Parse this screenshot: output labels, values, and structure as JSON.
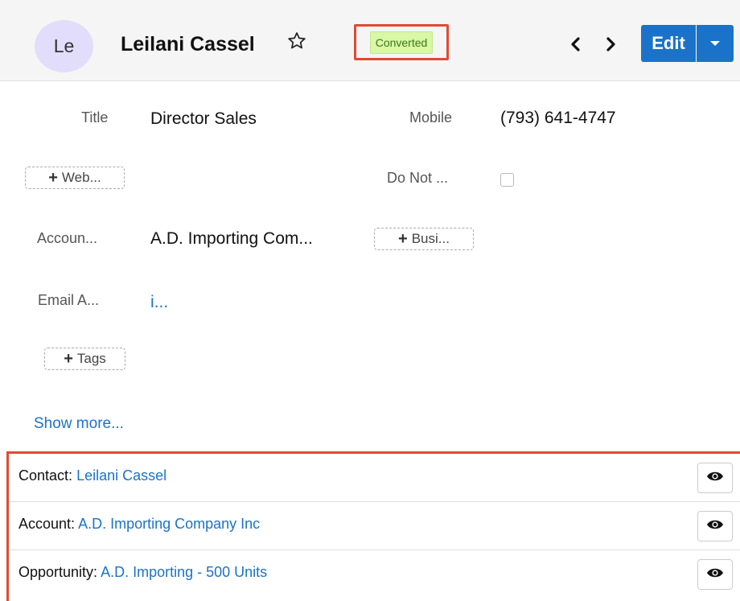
{
  "header": {
    "avatar_initials": "Le",
    "record_name": "Leilani Cassel",
    "status_badge": "Converted",
    "edit_label": "Edit",
    "icons": [
      "star-icon",
      "chevron-left-icon",
      "chevron-right-icon",
      "caret-down-icon"
    ],
    "colors": {
      "badge_bg": "#d8f7a7",
      "badge_text": "#3d7a0e",
      "primary": "#1a73c8",
      "highlight": "#e24a33"
    }
  },
  "fields": {
    "title_label": "Title",
    "title_value": "Director Sales",
    "mobile_label": "Mobile",
    "mobile_value": "(793) 641-4747",
    "website_add": "Web...",
    "do_not_label": "Do Not ...",
    "do_not_checked": false,
    "account_label": "Accoun...",
    "account_value": "A.D. Importing Com...",
    "business_add": "Busi...",
    "email_label": "Email A...",
    "email_value": "i...",
    "tags_add": "Tags",
    "show_more": "Show more..."
  },
  "related": [
    {
      "label": "Contact:",
      "link": "Leilani Cassel"
    },
    {
      "label": "Account:",
      "link": "A.D. Importing Company Inc"
    },
    {
      "label": "Opportunity:",
      "link": "A.D. Importing - 500 Units"
    }
  ]
}
